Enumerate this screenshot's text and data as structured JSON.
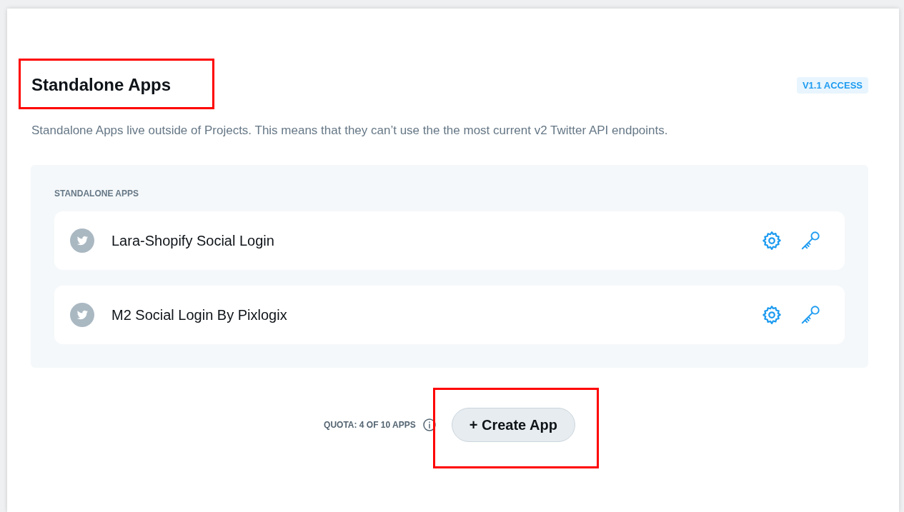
{
  "header": {
    "title": "Standalone Apps",
    "badge": "V1.1 ACCESS",
    "description": "Standalone Apps live outside of Projects. This means that they can’t use the the most current v2 Twitter API endpoints."
  },
  "apps_panel": {
    "label": "STANDALONE APPS",
    "apps": [
      {
        "name": "Lara-Shopify Social Login"
      },
      {
        "name": "M2 Social Login By Pixlogix"
      }
    ]
  },
  "footer": {
    "quota": "QUOTA: 4 OF 10 APPS",
    "create_button": "+ Create App"
  }
}
